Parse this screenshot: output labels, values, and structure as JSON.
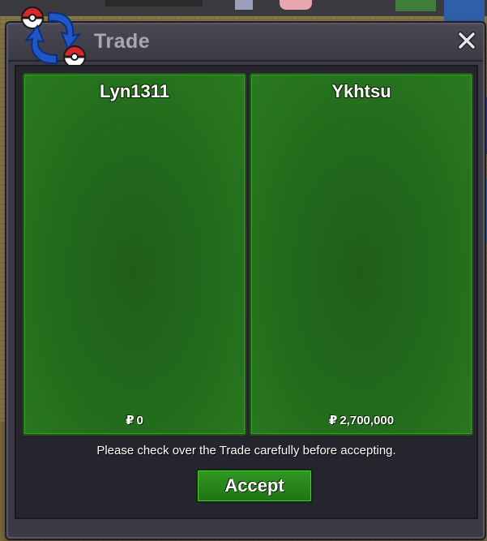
{
  "window": {
    "title": "Trade",
    "close_icon": "close-icon"
  },
  "trade": {
    "left": {
      "name": "Lyn1311",
      "money": "0",
      "currency_icon": "pokedollar-icon"
    },
    "right": {
      "name": "Ykhtsu",
      "money": "2,700,000",
      "currency_icon": "pokedollar-icon"
    }
  },
  "notice": "Please check over the Trade carefully before accepting.",
  "accept_label": "Accept",
  "colors": {
    "panel_green": "#236c1c",
    "button_green": "#2f9a22",
    "window_bg": "#3c3a44",
    "title_text": "#a9a7b3"
  }
}
